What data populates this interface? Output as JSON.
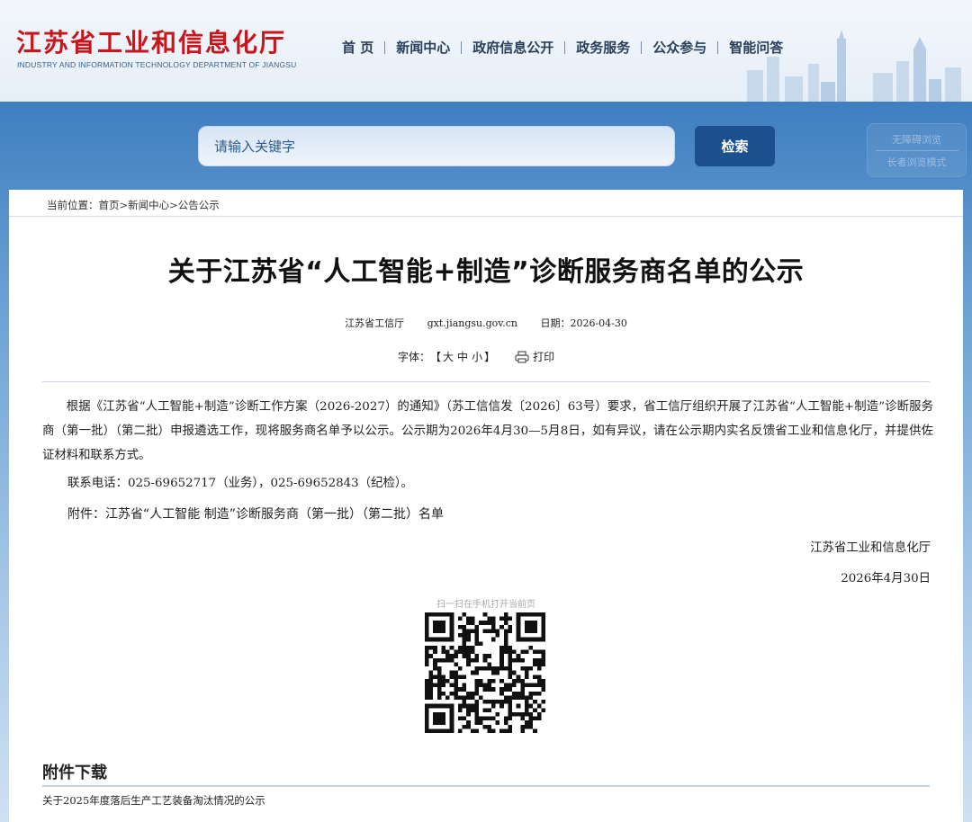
{
  "header": {
    "site_title": "江苏省工业和信息化厅",
    "site_subtitle": "INDUSTRY AND INFORMATION TECHNOLOGY DEPARTMENT OF JIANGSU",
    "nav": [
      "首 页",
      "新闻中心",
      "政府信息公开",
      "政务服务",
      "公众参与",
      "智能问答"
    ]
  },
  "search": {
    "placeholder": "请输入关键字",
    "button_label": "检索"
  },
  "accessibility": {
    "barrier_free": "无障碍浏览",
    "elder_mode": "长者浏览模式"
  },
  "breadcrumb": "当前位置：首页>新闻中心>公告公示",
  "article": {
    "title": "关于江苏省“人工智能+制造”诊断服务商名单的公示",
    "source": "江苏省工信厅",
    "site": "gxt.jiangsu.gov.cn",
    "date_label": "日期：2026-04-30",
    "font_label": "字体：",
    "font_open": "【",
    "font_large": "大",
    "font_medium": "中",
    "font_small": "小",
    "font_close": "】",
    "print_label": "打印",
    "body": "根据《江苏省“人工智能+制造”诊断工作方案（2026-2027）的通知》（苏工信信发〔2026〕63号）要求，省工信厅组织开展了江苏省“人工智能+制造”诊断服务商（第一批）（第二批）申报遴选工作，现将服务商名单予以公示。公示期为2026年4月30—5月8日，如有异议，请在公示期内实名反馈省工业和信息化厅，并提供佐证材料和联系方式。",
    "contact": "联系电话：025-69652717（业务），025-69652843（纪检）。",
    "attachment_label": "附件：",
    "attachment_link": "江苏省“人工智能 制造”诊断服务商（第一批）（第二批）名单",
    "signature_org": "江苏省工业和信息化厅",
    "signature_date": "2026年4月30日",
    "qr_caption": "扫一扫在手机打开当前页"
  },
  "downloads": {
    "title": "附件下载",
    "items": [
      "关于2025年度落后生产工艺装备淘汰情况的公示"
    ]
  },
  "colors": {
    "brand_red": "#c8161d",
    "nav_text": "#2a3f5a",
    "search_button": "#1b4f8e"
  }
}
